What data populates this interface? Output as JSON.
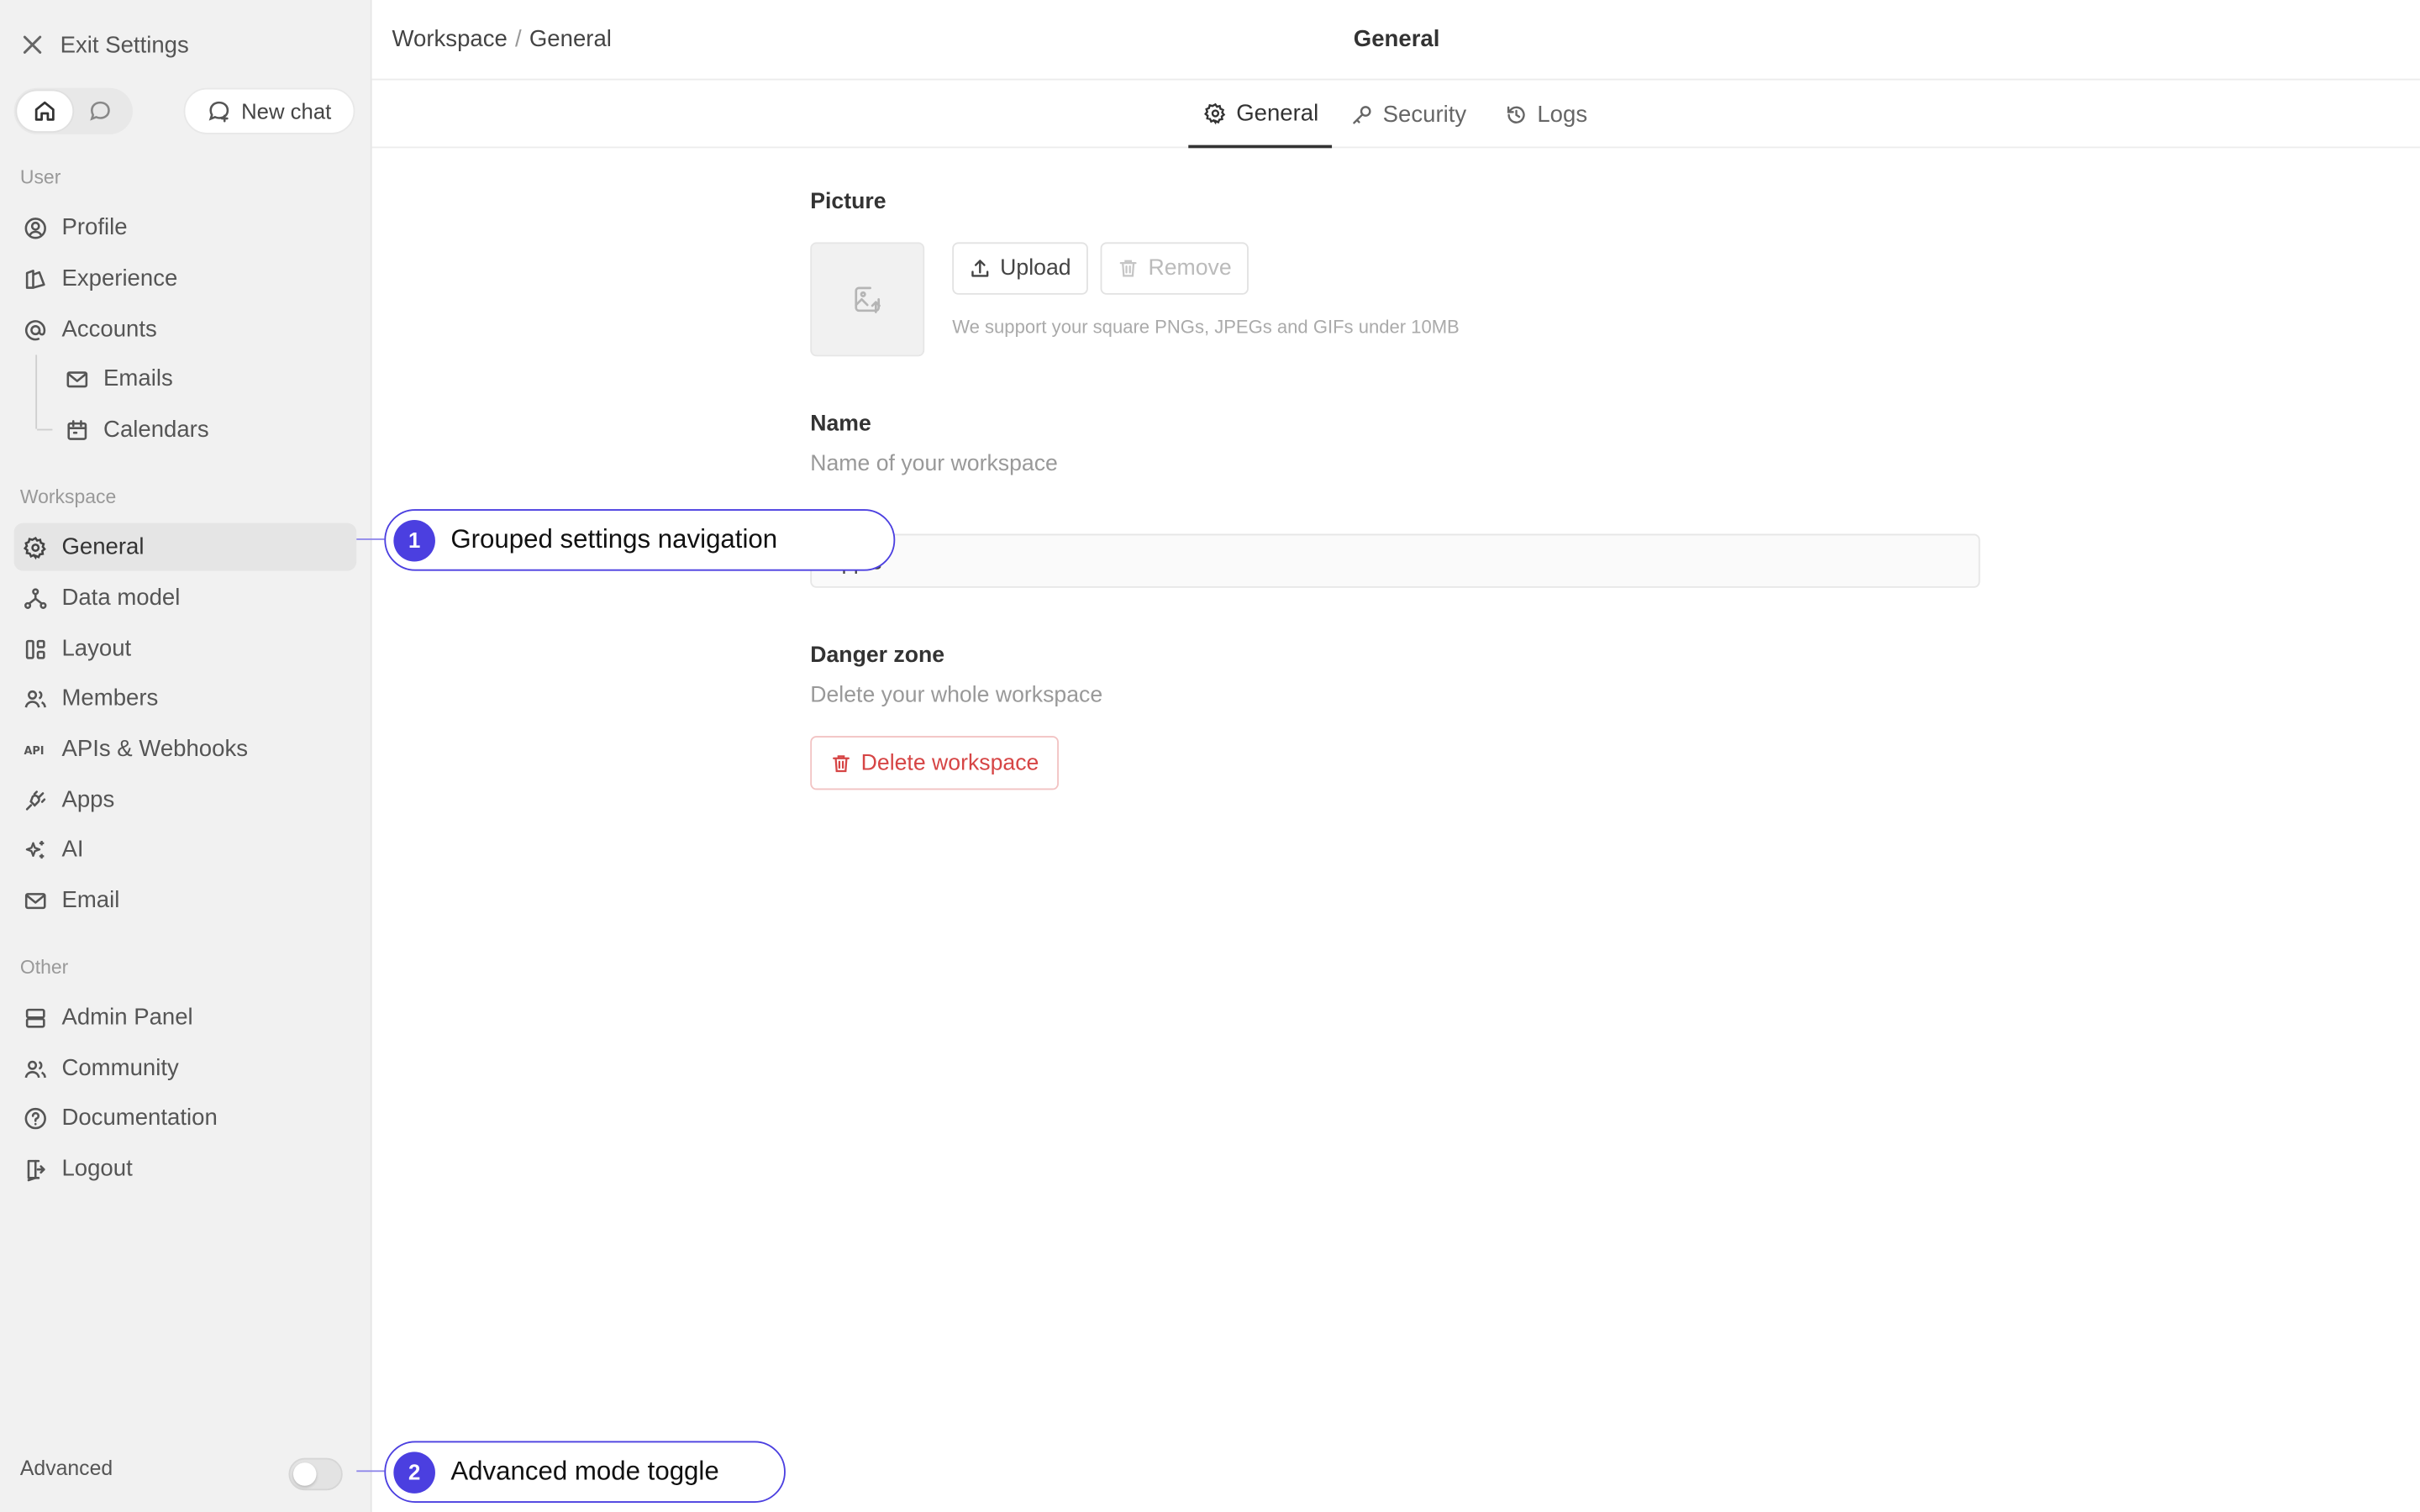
{
  "sidebar": {
    "exit_label": "Exit Settings",
    "new_chat_label": "New chat",
    "groups": {
      "user": "User",
      "workspace": "Workspace",
      "other": "Other"
    },
    "user_items": [
      "Profile",
      "Experience",
      "Accounts",
      "Emails",
      "Calendars"
    ],
    "workspace_items": [
      "General",
      "Data model",
      "Layout",
      "Members",
      "APIs & Webhooks",
      "Apps",
      "AI",
      "Email"
    ],
    "other_items": [
      "Admin Panel",
      "Community",
      "Documentation",
      "Logout"
    ],
    "advanced_label": "Advanced",
    "advanced_enabled": false
  },
  "topbar": {
    "breadcrumb": [
      "Workspace",
      "General"
    ],
    "breadcrumb_sep": "/",
    "title": "General"
  },
  "tabs": [
    {
      "label": "General",
      "icon": "gear-icon",
      "active": true
    },
    {
      "label": "Security",
      "icon": "key-icon",
      "active": false
    },
    {
      "label": "Logs",
      "icon": "history-icon",
      "active": false
    }
  ],
  "picture": {
    "title": "Picture",
    "upload_label": "Upload",
    "remove_label": "Remove",
    "hint": "We support your square PNGs, JPEGs and GIFs under 10MB"
  },
  "name": {
    "title": "Name",
    "description": "Name of your workspace",
    "value": "Apple"
  },
  "danger": {
    "title": "Danger zone",
    "description": "Delete your whole workspace",
    "button_label": "Delete workspace"
  },
  "callouts": [
    {
      "number": "1",
      "text": "Grouped settings navigation"
    },
    {
      "number": "2",
      "text": "Advanced mode toggle"
    }
  ],
  "colors": {
    "accent": "#4b3fe0",
    "danger": "#d64545",
    "sidebar_bg": "#f1f1f1"
  }
}
